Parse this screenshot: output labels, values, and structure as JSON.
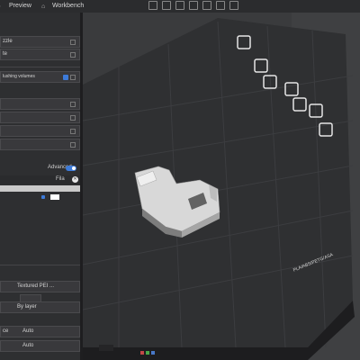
{
  "topbar": {
    "tabs": [
      {
        "label": "Preview"
      },
      {
        "label": "Workbench"
      }
    ]
  },
  "left_panel": {
    "fragments": {
      "item1": "zzle",
      "item2": "te",
      "flushing": "lushing volumes",
      "advanced_label": "Advanced",
      "table_header": "Fila",
      "plate_type": "Textured PEI ...",
      "by_layer": "By layer",
      "auto1_label": "ce",
      "auto1_value": "Auto",
      "auto2_value": "Auto"
    }
  },
  "viewport": {
    "bed_label": "PLA/ABS/PETG/ASA"
  }
}
